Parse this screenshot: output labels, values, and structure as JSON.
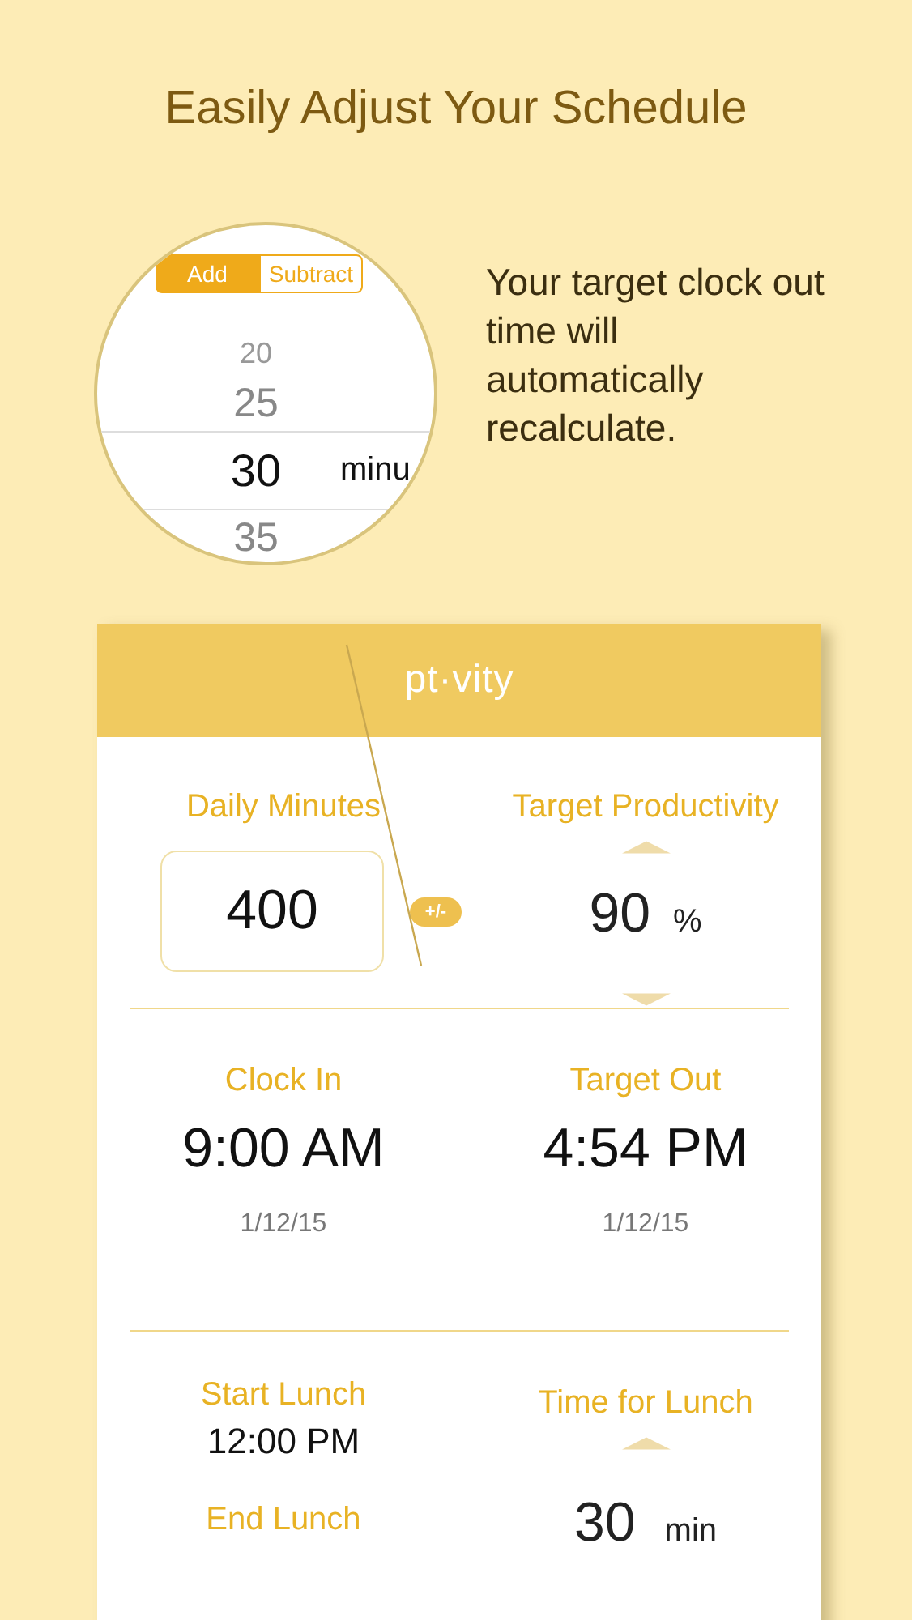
{
  "headline": "Easily Adjust Your Schedule",
  "magnifier": {
    "segments": [
      {
        "label": "Add",
        "selected": true
      },
      {
        "label": "Subtract",
        "selected": false
      }
    ],
    "picker": [
      {
        "value": "20",
        "selected": false
      },
      {
        "value": "25",
        "selected": false
      },
      {
        "value": "30",
        "selected": true
      },
      {
        "value": "35",
        "selected": false
      }
    ],
    "unit": "minu"
  },
  "callout": "Your target clock out time will automatically recalculate.",
  "app": {
    "title": "pt·vity",
    "daily_minutes": {
      "label": "Daily Minutes",
      "value": "400"
    },
    "adjust_button": "+/-",
    "target_productivity": {
      "label": "Target Productivity",
      "value": "90",
      "unit": "%"
    },
    "clock_in": {
      "label": "Clock In",
      "time": "9:00 AM",
      "date": "1/12/15"
    },
    "target_out": {
      "label": "Target Out",
      "time": "4:54 PM",
      "date": "1/12/15"
    },
    "start_lunch": {
      "label": "Start Lunch",
      "time": "12:00 PM"
    },
    "end_lunch": {
      "label": "End Lunch"
    },
    "time_for_lunch": {
      "label": "Time for Lunch",
      "value": "30",
      "unit": "min"
    }
  }
}
